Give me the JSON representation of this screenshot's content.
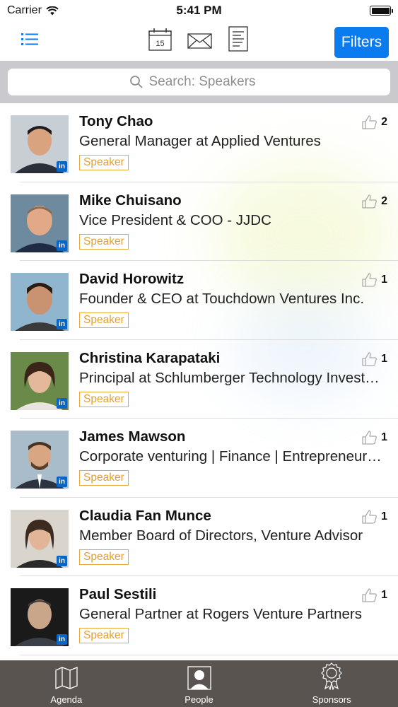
{
  "status": {
    "carrier": "Carrier",
    "time": "5:41 PM"
  },
  "nav": {
    "filters_label": "Filters",
    "icons": [
      "list-icon",
      "calendar-icon",
      "mail-icon",
      "notes-icon"
    ],
    "calendar_day": "15"
  },
  "search": {
    "placeholder": "Search: Speakers"
  },
  "colors": {
    "accent": "#0b7bf0",
    "tag": "#e0a035",
    "tab_bar": "#5a5450",
    "linkedin": "#0a66c2"
  },
  "people": [
    {
      "name": "Tony Chao",
      "title": "General Manager at Applied Ventures",
      "tag": "Speaker",
      "likes": "2",
      "badge": "in"
    },
    {
      "name": "Mike Chuisano",
      "title": "Vice President & COO - JJDC",
      "tag": "Speaker",
      "likes": "2",
      "badge": "in"
    },
    {
      "name": "David Horowitz",
      "title": "Founder & CEO at Touchdown Ventures Inc.",
      "tag": "Speaker",
      "likes": "1",
      "badge": "in"
    },
    {
      "name": "Christina Karapataki",
      "title": "Principal at Schlumberger Technology Investments",
      "tag": "Speaker",
      "likes": "1",
      "badge": "in"
    },
    {
      "name": "James Mawson",
      "title": "Corporate venturing | Finance | Entrepreneurship",
      "tag": "Speaker",
      "likes": "1",
      "badge": "in"
    },
    {
      "name": "Claudia Fan Munce",
      "title": "Member Board of Directors, Venture Advisor",
      "tag": "Speaker",
      "likes": "1",
      "badge": "in"
    },
    {
      "name": "Paul Sestili",
      "title": "General Partner at Rogers Venture Partners",
      "tag": "Speaker",
      "likes": "1",
      "badge": "in"
    }
  ],
  "tabs": [
    {
      "label": "Agenda",
      "icon": "map-icon"
    },
    {
      "label": "People",
      "icon": "person-icon"
    },
    {
      "label": "Sponsors",
      "icon": "award-icon"
    }
  ]
}
